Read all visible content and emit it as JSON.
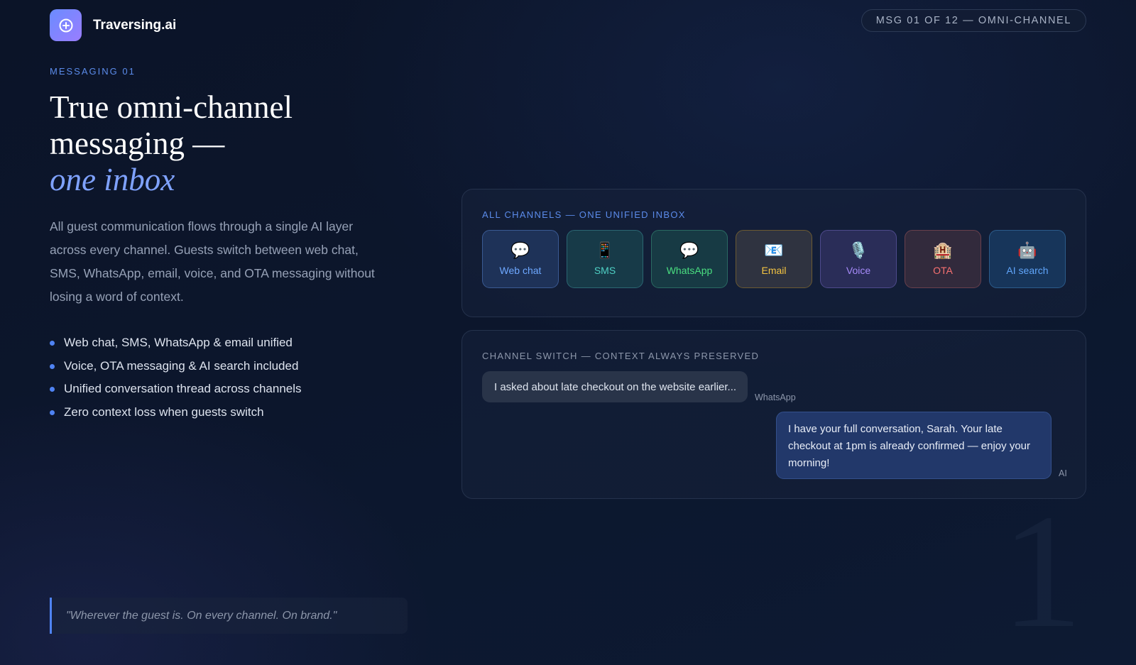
{
  "header": {
    "brand": "Traversing.ai",
    "logo_icon": "plus-circle-icon",
    "msg_pill": "MSG 01 OF 12 — OMNI-CHANNEL"
  },
  "hero": {
    "eyebrow": "MESSAGING 01",
    "headline_line1": "True omni-channel",
    "headline_line2": "messaging —",
    "headline_accent": "one inbox",
    "description": "All guest communication flows through a single AI layer across every channel. Guests switch between web chat, SMS, WhatsApp, email, voice, and OTA messaging without losing a word of context.",
    "bullets": [
      "Web chat, SMS, WhatsApp & email unified",
      "Voice, OTA messaging & AI search included",
      "Unified conversation thread across channels",
      "Zero context loss when guests switch"
    ],
    "quote": "\"Wherever the guest is. On every channel. On brand.\""
  },
  "channels_card": {
    "label": "ALL CHANNELS — ONE UNIFIED INBOX",
    "channels": [
      {
        "label": "Web chat",
        "icon": "💬",
        "icon_name": "speech-bubble-icon",
        "color": "#6ea8ff",
        "bg": "#1e3258",
        "border": "#3a5a93"
      },
      {
        "label": "SMS",
        "icon": "📱",
        "icon_name": "mobile-phone-icon",
        "color": "#4fd1c5",
        "bg": "#173a48",
        "border": "#2b6672"
      },
      {
        "label": "WhatsApp",
        "icon": "💬",
        "icon_name": "speech-bubble-icon",
        "color": "#4ade80",
        "bg": "#173a44",
        "border": "#2a6a62"
      },
      {
        "label": "Email",
        "icon": "📧",
        "icon_name": "email-icon",
        "color": "#f5c542",
        "bg": "#2f3340",
        "border": "#6b5a32"
      },
      {
        "label": "Voice",
        "icon": "🎙️",
        "icon_name": "microphone-icon",
        "color": "#a78bfa",
        "bg": "#2a2d58",
        "border": "#4e4a8c"
      },
      {
        "label": "OTA",
        "icon": "🏨",
        "icon_name": "hotel-icon",
        "color": "#f87171",
        "bg": "#322a3c",
        "border": "#69404c"
      },
      {
        "label": "AI search",
        "icon": "🤖",
        "icon_name": "robot-icon",
        "color": "#60a5fa",
        "bg": "#17355a",
        "border": "#2b5b8a"
      }
    ]
  },
  "switch_card": {
    "label": "CHANNEL SWITCH — CONTEXT ALWAYS PRESERVED",
    "guest_message": "I asked about late checkout on the website earlier...",
    "guest_channel": "WhatsApp",
    "ai_message": "I have your full conversation, Sarah. Your late checkout at 1pm is already confirmed — enjoy your morning!",
    "ai_tag": "AI"
  },
  "slide_number": "1"
}
